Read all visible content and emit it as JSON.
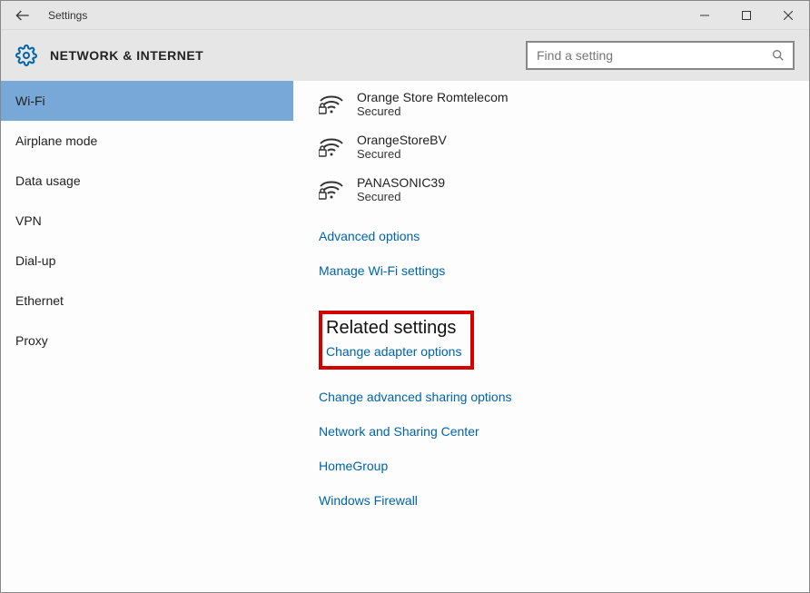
{
  "window": {
    "title": "Settings"
  },
  "header": {
    "section_title": "NETWORK & INTERNET",
    "search_placeholder": "Find a setting"
  },
  "sidebar": {
    "items": [
      {
        "label": "Wi-Fi",
        "active": true
      },
      {
        "label": "Airplane mode",
        "active": false
      },
      {
        "label": "Data usage",
        "active": false
      },
      {
        "label": "VPN",
        "active": false
      },
      {
        "label": "Dial-up",
        "active": false
      },
      {
        "label": "Ethernet",
        "active": false
      },
      {
        "label": "Proxy",
        "active": false
      }
    ]
  },
  "wifi_networks": [
    {
      "name": "Orange Store Romtelecom",
      "status": "Secured"
    },
    {
      "name": "OrangeStoreBV",
      "status": "Secured"
    },
    {
      "name": "PANASONIC39",
      "status": "Secured"
    }
  ],
  "links": {
    "advanced_options": "Advanced options",
    "manage_wifi": "Manage Wi-Fi settings"
  },
  "related": {
    "heading": "Related settings",
    "change_adapter": "Change adapter options",
    "change_sharing": "Change advanced sharing options",
    "network_center": "Network and Sharing Center",
    "homegroup": "HomeGroup",
    "firewall": "Windows Firewall"
  }
}
